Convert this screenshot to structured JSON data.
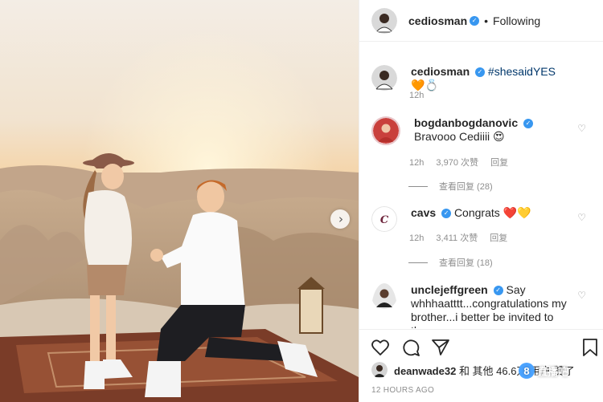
{
  "post": {
    "username": "cediosman",
    "follow_status": "Following",
    "caption_hashtag": "#shesaidYES",
    "caption_emoji": "🧡💍",
    "caption_time": "12h"
  },
  "comments": [
    {
      "username": "bogdanbogdanovic",
      "text": "Bravooo Cediiii 😍",
      "time": "12h",
      "likes": "3,970 次赞",
      "reply": "回复",
      "view_replies": "查看回复 (28)"
    },
    {
      "username": "cavs",
      "text": "Congrats ❤️💛",
      "time": "12h",
      "likes": "3,411 次赞",
      "reply": "回复",
      "view_replies": "查看回复 (18)"
    },
    {
      "username": "unclejeffgreen",
      "text": "Say whhhaatttt...congratulations my brother...i better be invited to the"
    }
  ],
  "likes_line": {
    "user": "deanwade32",
    "rest": " 和 其他 46.6万 用户 赞了"
  },
  "timestamp": "12 HOURS AGO",
  "watermark": {
    "logo": "8",
    "text": "直播吧"
  },
  "icons": {
    "next": "chevron-right-icon",
    "verified": "verified-badge-icon",
    "like": "heart-icon",
    "comment": "comment-icon",
    "share": "share-icon",
    "save": "bookmark-icon"
  },
  "colors": {
    "verified": "#3897f0",
    "hashtag": "#00376b",
    "muted": "#8e8e8e"
  }
}
